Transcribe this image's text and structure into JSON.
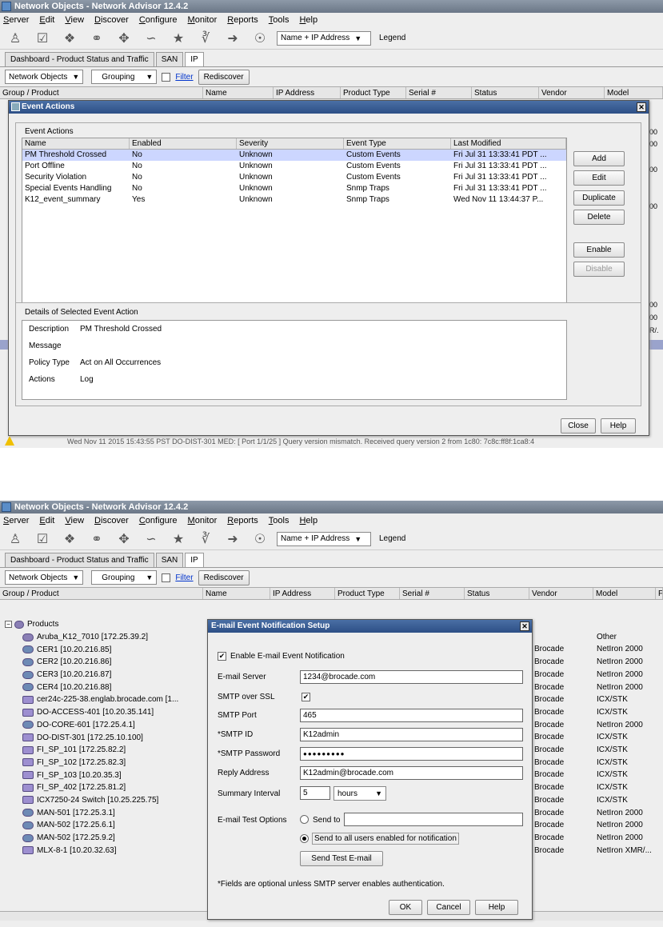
{
  "screen1": {
    "window_title": "Network Objects - Network Advisor 12.4.2",
    "menu": [
      "Server",
      "Edit",
      "View",
      "Discover",
      "Configure",
      "Monitor",
      "Reports",
      "Tools",
      "Help"
    ],
    "name_combo": "Name + IP Address",
    "legend": "Legend",
    "tabs": [
      "Dashboard - Product Status and Traffic",
      "SAN",
      "IP"
    ],
    "network_objects": "Network Objects",
    "grouping": "Grouping",
    "filter": "Filter",
    "rediscover": "Rediscover",
    "columns": [
      "Group / Product",
      "Name",
      "IP Address",
      "Product Type",
      "Serial #",
      "Status",
      "Vendor",
      "Model"
    ],
    "right_edge_text": [
      "00",
      "00",
      "00",
      "00",
      "00",
      "00",
      "R/."
    ],
    "bottom_log": "Wed Nov 11 2015 15:43:55 PST  DO-DIST-301 MED: [ Port 1/1/25 ] Query version mismatch. Received query version 2 from 1c80: 7c8c:ff8f:1ca8:4",
    "dialog": {
      "title": "Event Actions",
      "section_label": "Event Actions",
      "columns": [
        "Name",
        "Enabled",
        "Severity",
        "Event Type",
        "Last Modified"
      ],
      "rows": [
        {
          "name": "PM Threshold Crossed",
          "enabled": "No",
          "severity": "Unknown",
          "type": "Custom Events",
          "modified": "Fri Jul 31 13:33:41 PDT ..."
        },
        {
          "name": "Port Offline",
          "enabled": "No",
          "severity": "Unknown",
          "type": "Custom Events",
          "modified": "Fri Jul 31 13:33:41 PDT ..."
        },
        {
          "name": "Security Violation",
          "enabled": "No",
          "severity": "Unknown",
          "type": "Custom Events",
          "modified": "Fri Jul 31 13:33:41 PDT ..."
        },
        {
          "name": "Special Events Handling",
          "enabled": "No",
          "severity": "Unknown",
          "type": "Snmp Traps",
          "modified": "Fri Jul 31 13:33:41 PDT ..."
        },
        {
          "name": "K12_event_summary",
          "enabled": "Yes",
          "severity": "Unknown",
          "type": "Snmp Traps",
          "modified": "Wed Nov 11 13:44:37 P..."
        }
      ],
      "buttons": {
        "add": "Add",
        "edit": "Edit",
        "duplicate": "Duplicate",
        "delete": "Delete",
        "enable": "Enable",
        "disable": "Disable",
        "close": "Close",
        "help": "Help"
      },
      "details_label": "Details of Selected Event Action",
      "details": [
        {
          "k": "Description",
          "v": "PM Threshold Crossed"
        },
        {
          "k": "Message",
          "v": ""
        },
        {
          "k": "Policy Type",
          "v": "Act on All Occurrences"
        },
        {
          "k": "Actions",
          "v": "Log"
        }
      ]
    }
  },
  "screen2": {
    "window_title": "Network Objects - Network Advisor 12.4.2",
    "menu": [
      "Server",
      "Edit",
      "View",
      "Discover",
      "Configure",
      "Monitor",
      "Reports",
      "Tools",
      "Help"
    ],
    "name_combo": "Name + IP Address",
    "legend": "Legend",
    "tabs": [
      "Dashboard - Product Status and Traffic",
      "SAN",
      "IP"
    ],
    "network_objects": "Network Objects",
    "grouping": "Grouping",
    "filter": "Filter",
    "rediscover": "Rediscover",
    "columns": [
      "Group / Product",
      "Name",
      "IP Address",
      "Product Type",
      "Serial #",
      "Status",
      "Vendor",
      "Model",
      "F"
    ],
    "tree_root": "Products",
    "tree": [
      {
        "label": "Aruba_K12_7010 [172.25.39.2]",
        "vendor": "",
        "model": "Other"
      },
      {
        "label": "CER1 [10.20.216.85]",
        "vendor": "Brocade",
        "model": "NetIron 2000"
      },
      {
        "label": "CER2 [10.20.216.86]",
        "vendor": "Brocade",
        "model": "NetIron 2000"
      },
      {
        "label": "CER3 [10.20.216.87]",
        "vendor": "Brocade",
        "model": "NetIron 2000"
      },
      {
        "label": "CER4 [10.20.216.88]",
        "vendor": "Brocade",
        "model": "NetIron 2000"
      },
      {
        "label": "cer24c-225-38.englab.brocade.com [1...",
        "vendor": "Brocade",
        "model": "ICX/STK"
      },
      {
        "label": "DO-ACCESS-401 [10.20.35.141]",
        "vendor": "Brocade",
        "model": "ICX/STK"
      },
      {
        "label": "DO-CORE-601 [172.25.4.1]",
        "vendor": "Brocade",
        "model": "NetIron 2000"
      },
      {
        "label": "DO-DIST-301 [172.25.10.100]",
        "vendor": "Brocade",
        "model": "ICX/STK"
      },
      {
        "label": "FI_SP_101 [172.25.82.2]",
        "vendor": "Brocade",
        "model": "ICX/STK"
      },
      {
        "label": "FI_SP_102 [172.25.82.3]",
        "vendor": "Brocade",
        "model": "ICX/STK"
      },
      {
        "label": "FI_SP_103 [10.20.35.3]",
        "vendor": "Brocade",
        "model": "ICX/STK"
      },
      {
        "label": "FI_SP_402 [172.25.81.2]",
        "vendor": "Brocade",
        "model": "ICX/STK"
      },
      {
        "label": "ICX7250-24 Switch [10.25.225.75]",
        "vendor": "Brocade",
        "model": "ICX/STK"
      },
      {
        "label": "MAN-501 [172.25.3.1]",
        "vendor": "Brocade",
        "model": "NetIron 2000"
      },
      {
        "label": "MAN-502 [172.25.6.1]",
        "vendor": "Brocade",
        "model": "NetIron 2000"
      },
      {
        "label": "MAN-502 [172.25.9.2]",
        "vendor": "Brocade",
        "model": "NetIron 2000"
      },
      {
        "label": "MLX-8-1 [10.20.32.63]",
        "vendor": "Brocade",
        "model": "NetIron XMR/..."
      }
    ],
    "dialog": {
      "title": "E-mail Event Notification Setup",
      "enable_label": "Enable E-mail Event Notification",
      "email_server_label": "E-mail Server",
      "email_server": "1234@brocade.com",
      "ssl_label": "SMTP over SSL",
      "port_label": "SMTP Port",
      "port": "465",
      "id_label": "*SMTP ID",
      "id": "K12admin",
      "password_label": "*SMTP Password",
      "password": "●●●●●●●●●",
      "reply_label": "Reply Address",
      "reply": "K12admin@brocade.com",
      "interval_label": "Summary Interval",
      "interval": "5",
      "interval_unit": "hours",
      "test_label": "E-mail Test Options",
      "send_to": "Send to",
      "send_all": "Send to all users enabled for notification",
      "send_test": "Send Test E-mail",
      "footnote": "*Fields are optional unless SMTP server enables authentication.",
      "ok": "OK",
      "cancel": "Cancel",
      "help": "Help"
    }
  }
}
